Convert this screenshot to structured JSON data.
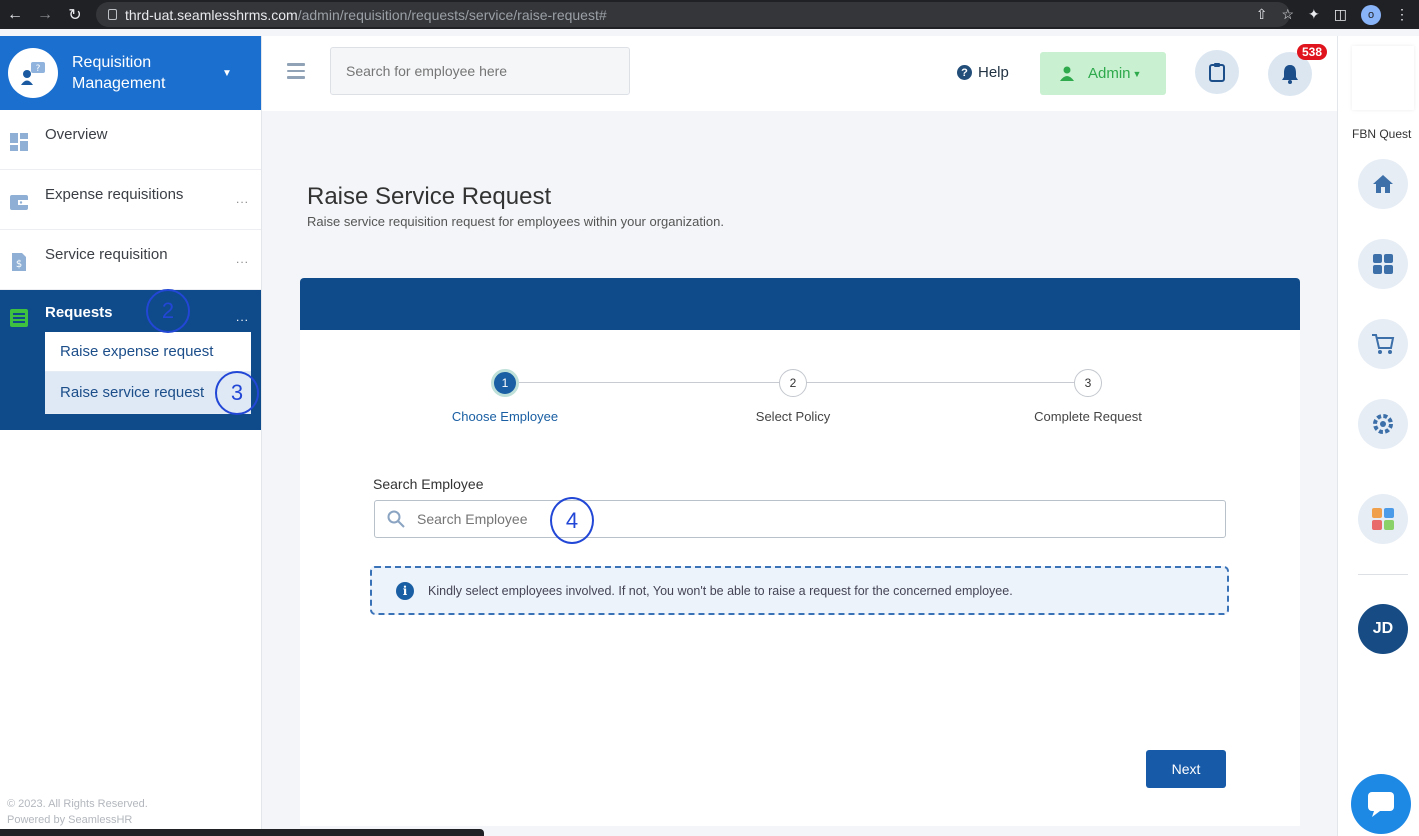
{
  "browser": {
    "url_domain": "thrd-uat.seamlesshrms.com",
    "url_path": "/admin/requisition/requests/service/raise-request#",
    "profile_initial": "o"
  },
  "sidebar": {
    "brand_title": "Requisition Management",
    "items": [
      {
        "label": "Overview",
        "icon": "dashboard-icon"
      },
      {
        "label": "Expense requisitions",
        "icon": "wallet-icon",
        "more": "..."
      },
      {
        "label": "Service requisition",
        "icon": "dollar-document-icon",
        "more": "..."
      }
    ],
    "active": {
      "label": "Requests",
      "more": "...",
      "icon": "list-icon",
      "submenu": [
        "Raise expense request",
        "Raise service request"
      ]
    },
    "footer_line1": "© 2023. All Rights Reserved.",
    "footer_line2": "Powered by SeamlessHR"
  },
  "annotations": [
    "2",
    "3",
    "4"
  ],
  "header": {
    "search_placeholder": "Search for employee here",
    "help_label": "Help",
    "admin_label": "Admin",
    "notification_count": "538"
  },
  "rail": {
    "org_name": "FBN Quest",
    "avatar_initials": "JD",
    "icons": [
      "home-icon",
      "grid-icon",
      "cart-icon",
      "settings-icon",
      "apps-icon"
    ]
  },
  "main": {
    "title": "Raise Service Request",
    "subtitle": "Raise service requisition request for employees within your organization.",
    "steps": [
      {
        "num": "1",
        "label": "Choose Employee",
        "active": true
      },
      {
        "num": "2",
        "label": "Select Policy",
        "active": false
      },
      {
        "num": "3",
        "label": "Complete Request",
        "active": false
      }
    ],
    "search_label": "Search Employee",
    "search_placeholder": "Search Employee",
    "info_text": "Kindly select employees involved. If not, You won't be able to raise a request for the concerned employee.",
    "next_label": "Next"
  },
  "colors": {
    "primary": "#0f4a8a",
    "brand": "#1b6fcf",
    "admin_green": "#2ea94c",
    "badge_red": "#e0141d"
  }
}
